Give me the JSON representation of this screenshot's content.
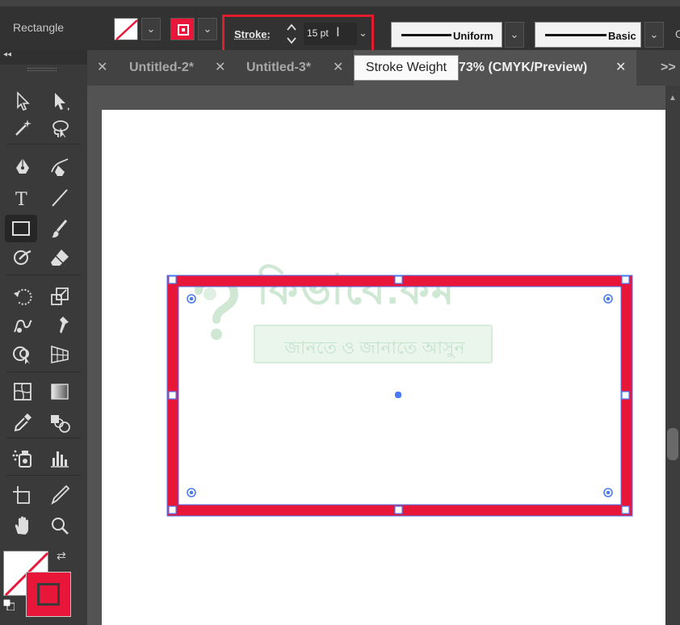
{
  "control_bar": {
    "tool_name": "Rectangle",
    "stroke_label": "Stroke:",
    "stroke_value": "15 pt",
    "profile1": "Uniform",
    "profile2": "Basic",
    "overflow_text": "G"
  },
  "tooltip": "Stroke Weight",
  "tabs": [
    {
      "label": "Untitled-2*"
    },
    {
      "label": "Untitled-3*"
    },
    {
      "label": "73% (CMYK/Preview)"
    }
  ],
  "tab_overflow": ">>",
  "watermark": {
    "title": "কিভাবে.কম",
    "subtitle": "জানতে ও জানাতে আসুন"
  },
  "colors": {
    "accent_stroke": "#e8173a",
    "selection": "#4b7bf5",
    "highlight_box": "#e11d2d"
  },
  "icons": [
    "selection-tool-icon",
    "direct-selection-tool-icon",
    "magic-wand-icon",
    "lasso-icon",
    "pen-tool-icon",
    "curvature-tool-icon",
    "type-tool-icon",
    "line-tool-icon",
    "rectangle-tool-icon",
    "paintbrush-icon",
    "shaper-tool-icon",
    "eraser-icon",
    "rotate-tool-icon",
    "scale-tool-icon",
    "warp-tool-icon",
    "puppet-warp-icon",
    "shape-builder-icon",
    "perspective-grid-icon",
    "mesh-tool-icon",
    "gradient-tool-icon",
    "eyedropper-icon",
    "blend-tool-icon",
    "symbol-sprayer-icon",
    "graph-tool-icon",
    "artboard-tool-icon",
    "slice-tool-icon",
    "hand-tool-icon",
    "zoom-tool-icon"
  ]
}
